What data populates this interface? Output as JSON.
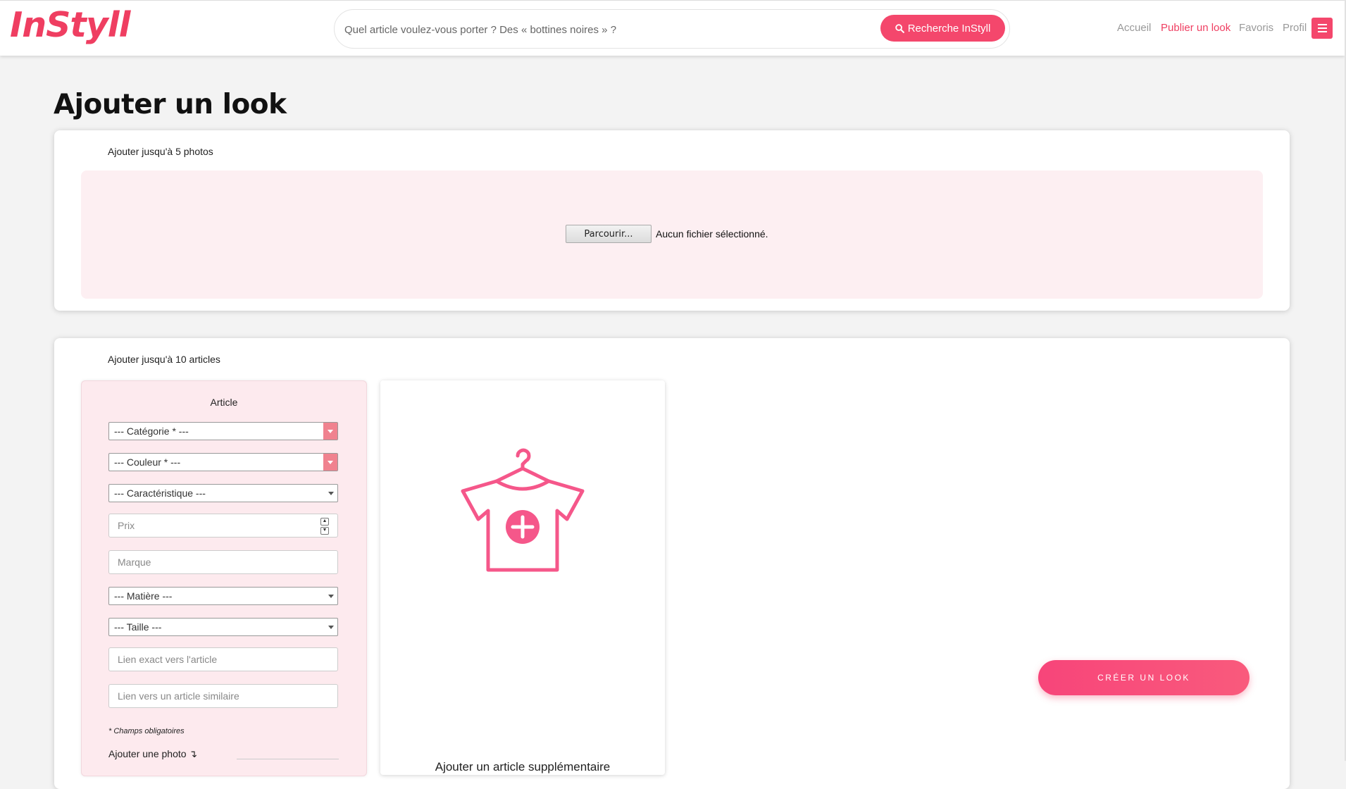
{
  "header": {
    "logo": "InStyll",
    "search_placeholder": "Quel article voulez-vous porter ? Des « bottines noires » ?",
    "search_button": "Recherche InStyll",
    "nav": {
      "home": "Accueil",
      "publish": "Publier un look",
      "favorites": "Favoris",
      "profile": "Profil"
    }
  },
  "page": {
    "title": "Ajouter un look"
  },
  "photos": {
    "label": "Ajouter jusqu'à 5 photos",
    "browse_button": "Parcourir...",
    "file_status": "Aucun fichier sélectionné."
  },
  "articles": {
    "label": "Ajouter jusqu'à 10 articles",
    "form": {
      "title": "Article",
      "category": "--- Catégorie * ---",
      "color": "--- Couleur * ---",
      "feature": "--- Caractéristique ---",
      "price_placeholder": "Prix",
      "brand_placeholder": "Marque",
      "material": "--- Matière ---",
      "size": "--- Taille ---",
      "exact_link_placeholder": "Lien exact vers l'article",
      "similar_link_placeholder": "Lien vers un article similaire",
      "required_note": "* Champs obligatoires",
      "add_photo": "Ajouter une photo ↴"
    },
    "add_more_label": "Ajouter un article supplémentaire"
  },
  "actions": {
    "create_look": "CRÉER UN LOOK"
  },
  "colors": {
    "brand": "#ef3e61",
    "accent": "#f4476c"
  },
  "icons": {
    "search": "search-icon",
    "menu": "hamburger-menu-icon",
    "add_article": "shirt-hanger-plus-icon"
  }
}
